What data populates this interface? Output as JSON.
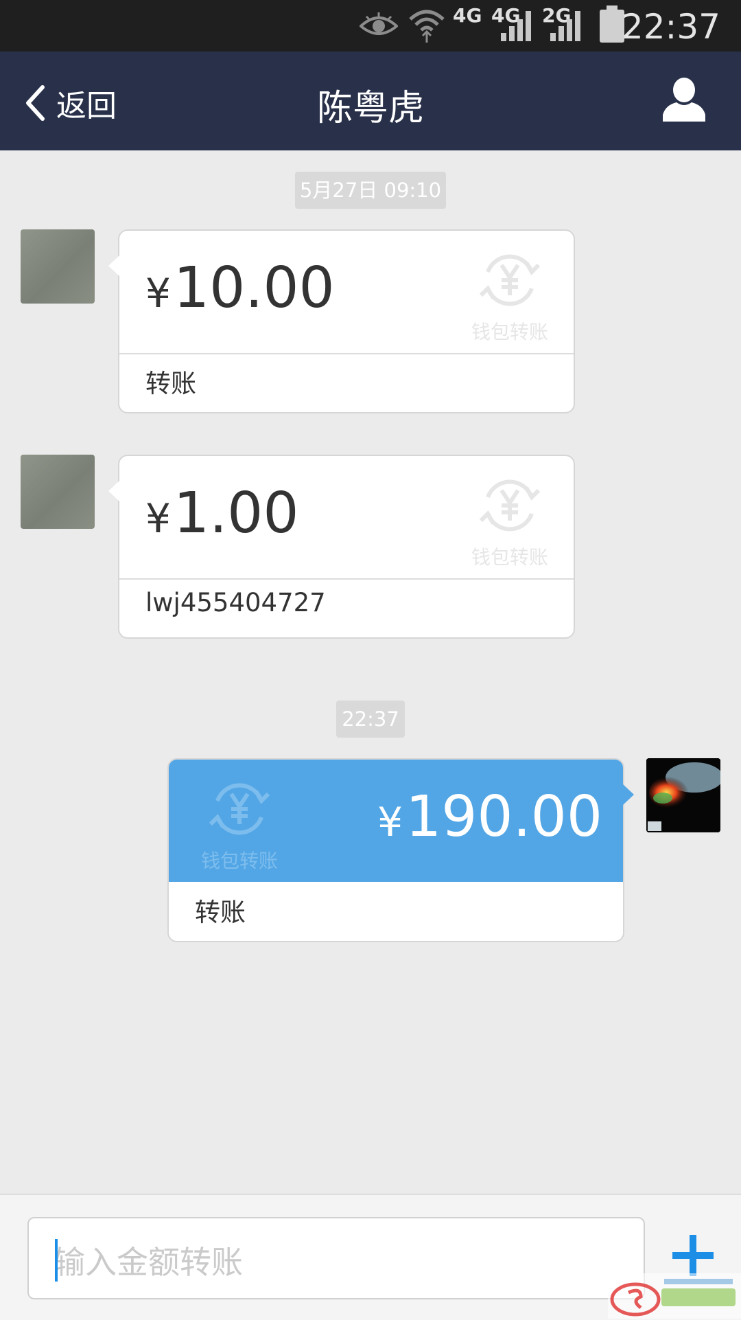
{
  "status_bar": {
    "time": "22:37",
    "signal_labels": [
      "4G",
      "4G",
      "2G"
    ],
    "icons": [
      "eye-icon",
      "wifi-icon",
      "signal-icon",
      "battery-icon"
    ]
  },
  "header": {
    "back_label": "返回",
    "title": "陈粤虎",
    "icons": [
      "chevron-left-icon",
      "profile-icon"
    ]
  },
  "messages": [
    {
      "type": "timestamp",
      "text": "5月27日 09:10"
    },
    {
      "type": "transfer",
      "direction": "received",
      "currency": "¥",
      "amount": "10.00",
      "note": "转账",
      "badge": "钱包转账"
    },
    {
      "type": "transfer",
      "direction": "received",
      "currency": "¥",
      "amount": "1.00",
      "note": "lwj455404727",
      "badge": "钱包转账"
    },
    {
      "type": "timestamp",
      "text": "22:37"
    },
    {
      "type": "transfer",
      "direction": "sent",
      "currency": "¥",
      "amount": "190.00",
      "note": "转账",
      "badge": "钱包转账"
    }
  ],
  "input": {
    "placeholder": "输入金额转账",
    "value": ""
  },
  "colors": {
    "nav_bg": "#28304a",
    "sent_bubble": "#53a6e5",
    "accent": "#1d8ee6",
    "chat_bg": "#ebebeb"
  }
}
